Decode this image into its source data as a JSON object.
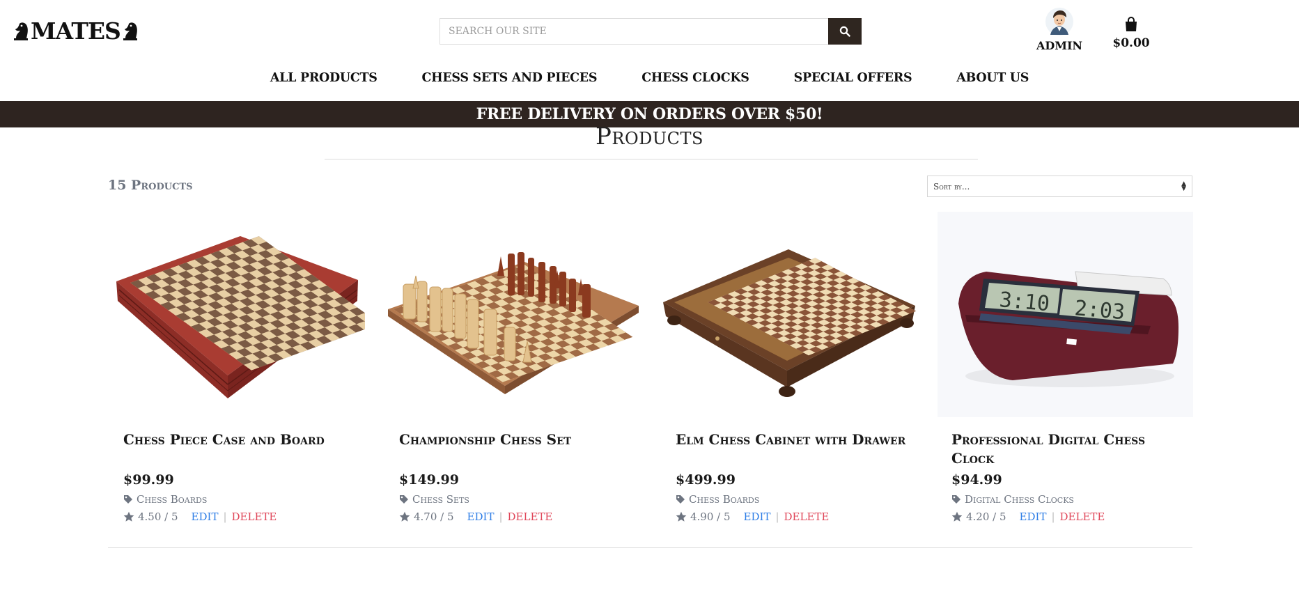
{
  "brand": {
    "name": "MATES",
    "accent": "#2e2420",
    "edit_color": "#2f7ee6",
    "delete_color": "#e0475a"
  },
  "search": {
    "placeholder": "SEARCH OUR SITE",
    "icon": "search-icon"
  },
  "user": {
    "label": "ADMIN"
  },
  "cart": {
    "label": "$0.00",
    "icon": "shopping-bag-icon"
  },
  "nav": {
    "items": [
      "ALL PRODUCTS",
      "CHESS SETS AND PIECES",
      "CHESS CLOCKS",
      "SPECIAL OFFERS",
      "ABOUT US"
    ]
  },
  "banner": {
    "text": "FREE DELIVERY ON ORDERS OVER $50!"
  },
  "products_page": {
    "title": "Products",
    "count": "15 Products",
    "sort_label": "Sort by..."
  },
  "products": [
    {
      "name": "Chess Piece Case and Board",
      "price": "$99.99",
      "category": "Chess Boards",
      "rating": "4.50 / 5",
      "edit": "EDIT",
      "delete": "DELETE"
    },
    {
      "name": "Championship Chess Set",
      "price": "$149.99",
      "category": "Chess Sets",
      "rating": "4.70 / 5",
      "edit": "EDIT",
      "delete": "DELETE"
    },
    {
      "name": "Elm Chess Cabinet with Drawer",
      "price": "$499.99",
      "category": "Chess Boards",
      "rating": "4.90 / 5",
      "edit": "EDIT",
      "delete": "DELETE"
    },
    {
      "name": "Professional Digital Chess Clock",
      "price": "$94.99",
      "category": "Digital Chess Clocks",
      "rating": "4.20 / 5",
      "edit": "EDIT",
      "delete": "DELETE",
      "clock_left": "3:10",
      "clock_right": "2:03"
    }
  ]
}
